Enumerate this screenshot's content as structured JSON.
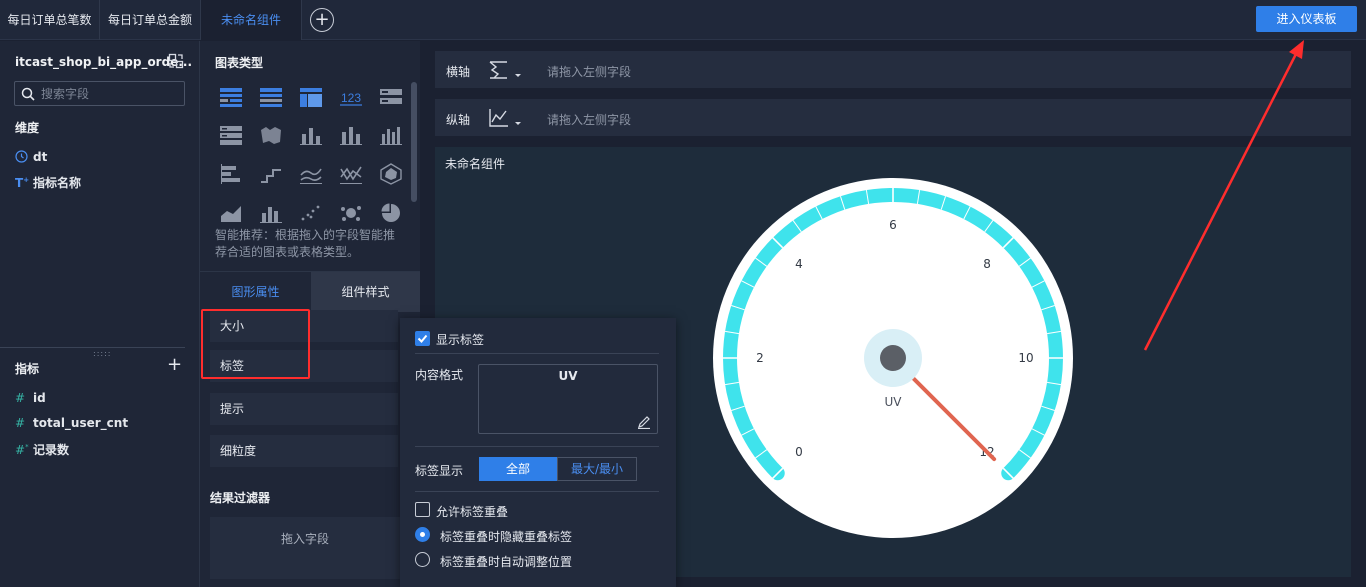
{
  "tabs": [
    {
      "label": "每日订单总笔数"
    },
    {
      "label": "每日订单总金额"
    },
    {
      "label": "未命名组件"
    }
  ],
  "enter_dashboard_label": "进入仪表板",
  "datasource": {
    "name": "itcast_shop_bi_app_orde..."
  },
  "search": {
    "placeholder": "搜索字段"
  },
  "dimensions": {
    "title": "维度",
    "items": [
      {
        "type_icon": "clock-icon",
        "label": "dt"
      },
      {
        "type_icon": "text-type-icon",
        "label": "指标名称"
      }
    ]
  },
  "measures": {
    "title": "指标",
    "items": [
      {
        "type_icon": "hash-icon",
        "label": "id"
      },
      {
        "type_icon": "hash-icon",
        "label": "total_user_cnt"
      },
      {
        "type_icon": "hash-star-icon",
        "label": "记录数"
      }
    ]
  },
  "chart_types": {
    "title": "图表类型",
    "smart_hint": "智能推荐：根据拖入的字段智能推荐合适的图表或表格类型。"
  },
  "style_tabs": [
    {
      "label": "图形属性",
      "active": false
    },
    {
      "label": "组件样式",
      "active": true
    }
  ],
  "property_sections": [
    "大小",
    "标签",
    "提示",
    "细粒度"
  ],
  "result_filter": {
    "title": "结果过滤器",
    "drop_hint": "拖入字段"
  },
  "x_axis": {
    "label": "横轴",
    "placeholder": "请拖入左侧字段"
  },
  "y_axis": {
    "label": "纵轴",
    "placeholder": "请拖入左侧字段"
  },
  "canvas": {
    "title": "未命名组件"
  },
  "label_popup": {
    "show_label": "显示标签",
    "show_label_checked": true,
    "content_format_label": "内容格式",
    "content_format_value": "UV",
    "label_display_label": "标签显示",
    "label_display_options": [
      "全部",
      "最大/最小"
    ],
    "label_display_selected": "全部",
    "allow_overlap_label": "允许标签重叠",
    "allow_overlap_checked": false,
    "overlap_options": [
      "标签重叠时隐藏重叠标签",
      "标签重叠时自动调整位置"
    ],
    "overlap_selected": "标签重叠时隐藏重叠标签"
  },
  "chart_data": {
    "type": "gauge",
    "min": 0,
    "max": 12,
    "ticks": [
      0,
      2,
      4,
      6,
      8,
      10,
      12
    ],
    "value_label": "UV",
    "pointer_value": 12,
    "arc_color": "#3fe3ec",
    "needle_color": "#e06550",
    "hub_color": "#5b5f66"
  },
  "colors": {
    "accent": "#2f7fe8",
    "annotation": "#ff2d2d"
  }
}
